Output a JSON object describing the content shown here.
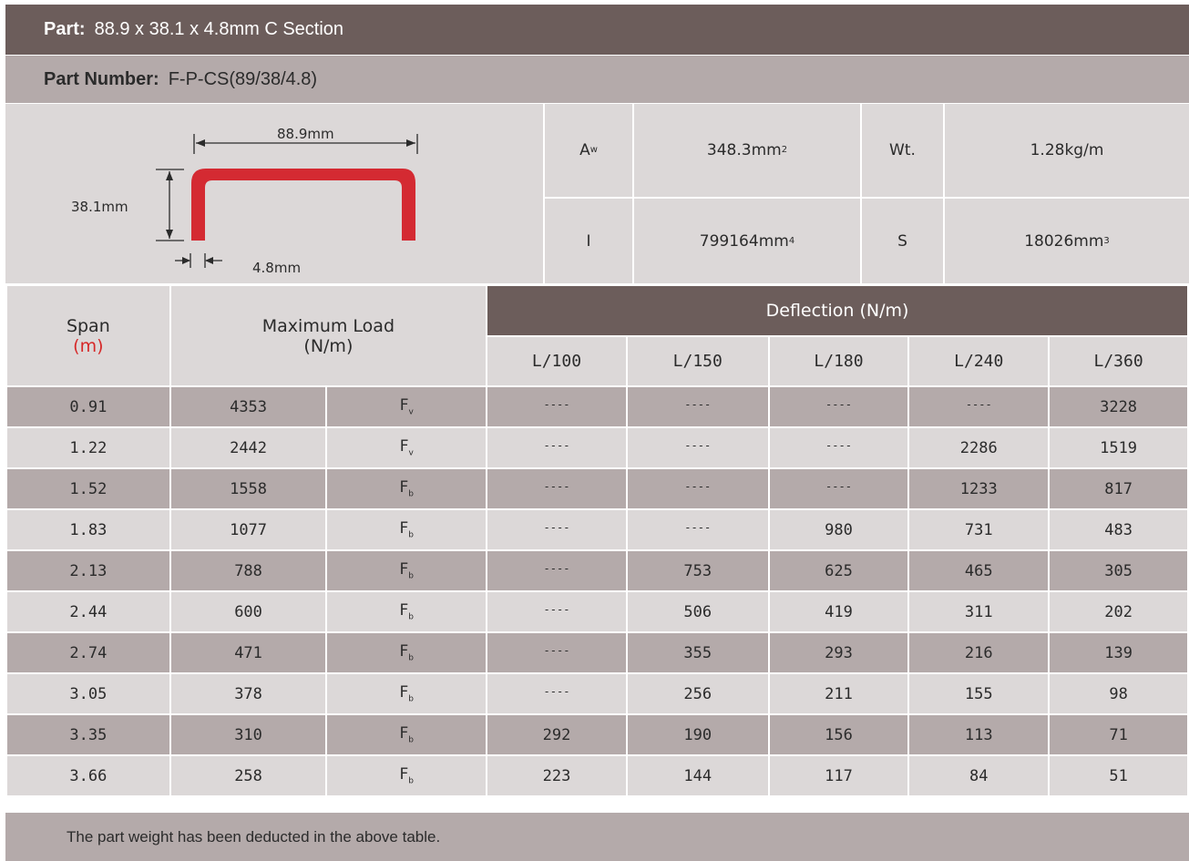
{
  "part": {
    "label": "Part:",
    "value": "88.9 x 38.1 x 4.8mm C Section"
  },
  "part_number": {
    "label": "Part Number:",
    "value": "F-P-CS(89/38/4.8)"
  },
  "diagram": {
    "width_label": "88.9mm",
    "height_label": "38.1mm",
    "thickness_label": "4.8mm",
    "section_color": "#d42a32"
  },
  "properties": {
    "aw_label": "A",
    "aw_sub": "w",
    "aw_value": "348.3mm",
    "aw_exp": "2",
    "wt_label": "Wt.",
    "wt_value": "1.28kg/m",
    "i_label": "I",
    "i_value": "799164mm",
    "i_exp": "4",
    "s_label": "S",
    "s_value": "18026mm",
    "s_exp": "3"
  },
  "table": {
    "span_header": "Span",
    "span_unit": "(m)",
    "max_load_header": "Maximum Load",
    "max_load_unit": "(N/m)",
    "deflection_header": "Deflection (N/m)",
    "deflection_cols": [
      "L/100",
      "L/150",
      "L/180",
      "L/240",
      "L/360"
    ],
    "rows": [
      {
        "span": "0.91",
        "load": "4353",
        "sym": "F",
        "sub": "v",
        "d": [
          "----",
          "----",
          "----",
          "----",
          "3228"
        ]
      },
      {
        "span": "1.22",
        "load": "2442",
        "sym": "F",
        "sub": "v",
        "d": [
          "----",
          "----",
          "----",
          "2286",
          "1519"
        ]
      },
      {
        "span": "1.52",
        "load": "1558",
        "sym": "F",
        "sub": "b",
        "d": [
          "----",
          "----",
          "----",
          "1233",
          "817"
        ]
      },
      {
        "span": "1.83",
        "load": "1077",
        "sym": "F",
        "sub": "b",
        "d": [
          "----",
          "----",
          "980",
          "731",
          "483"
        ]
      },
      {
        "span": "2.13",
        "load": "788",
        "sym": "F",
        "sub": "b",
        "d": [
          "----",
          "753",
          "625",
          "465",
          "305"
        ]
      },
      {
        "span": "2.44",
        "load": "600",
        "sym": "F",
        "sub": "b",
        "d": [
          "----",
          "506",
          "419",
          "311",
          "202"
        ]
      },
      {
        "span": "2.74",
        "load": "471",
        "sym": "F",
        "sub": "b",
        "d": [
          "----",
          "355",
          "293",
          "216",
          "139"
        ]
      },
      {
        "span": "3.05",
        "load": "378",
        "sym": "F",
        "sub": "b",
        "d": [
          "----",
          "256",
          "211",
          "155",
          "98"
        ]
      },
      {
        "span": "3.35",
        "load": "310",
        "sym": "F",
        "sub": "b",
        "d": [
          "292",
          "190",
          "156",
          "113",
          "71"
        ]
      },
      {
        "span": "3.66",
        "load": "258",
        "sym": "F",
        "sub": "b",
        "d": [
          "223",
          "144",
          "117",
          "84",
          "51"
        ]
      }
    ]
  },
  "footer_note": "The part weight has been deducted in the above table.",
  "colors": {
    "dark_band": "#6c5d5b",
    "mid_band": "#b4aaaa",
    "light_band": "#dcd8d8",
    "accent_red": "#d62828"
  }
}
